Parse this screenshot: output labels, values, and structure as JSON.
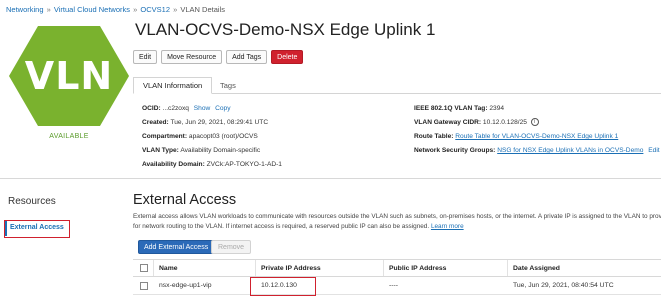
{
  "breadcrumb": {
    "items": [
      "Networking",
      "Virtual Cloud Networks",
      "OCVS12",
      "VLAN Details"
    ],
    "separator": "»"
  },
  "resource_icon": {
    "label": "VLN",
    "color": "#7ab22e"
  },
  "status": "AVAILABLE",
  "title": "VLAN-OCVS-Demo-NSX Edge Uplink 1",
  "actions": {
    "edit": "Edit",
    "move": "Move Resource",
    "tags": "Add Tags",
    "delete": "Delete"
  },
  "tabs": {
    "info": "VLAN Information",
    "tags": "Tags"
  },
  "info_left": {
    "ocid_label": "OCID:",
    "ocid_value": "...c2zoxq",
    "ocid_show": "Show",
    "ocid_copy": "Copy",
    "created_label": "Created:",
    "created_value": "Tue, Jun 29, 2021, 08:29:41 UTC",
    "compartment_label": "Compartment:",
    "compartment_value": "apacopt03 (root)/OCVS",
    "type_label": "VLAN Type:",
    "type_value": "Availability Domain-specific",
    "ad_label": "Availability Domain:",
    "ad_value": "ZVCk:AP-TOKYO-1-AD-1"
  },
  "info_right": {
    "tag_label": "IEEE 802.1Q VLAN Tag:",
    "tag_value": "2394",
    "cidr_label": "VLAN Gateway CIDR:",
    "cidr_value": "10.12.0.128/25",
    "cidr_info": "i",
    "route_label": "Route Table:",
    "route_value": "Route Table for VLAN-OCVS-Demo-NSX Edge Uplink 1",
    "nsg_label": "Network Security Groups:",
    "nsg_value": "NSG for NSX Edge Uplink VLANs in OCVS-Demo",
    "nsg_edit": "Edit"
  },
  "resources": {
    "heading": "Resources",
    "item": "External Access"
  },
  "section": {
    "title": "External Access",
    "desc_line1": "External access allows VLAN workloads to communicate with resources outside the VLAN such as subnets, on-premises hosts, or the internet. A private IP is assigned to the VLAN to prov",
    "desc_line2": "for network routing to the VLAN. If internet access is required, a reserved public IP can also be assigned.",
    "learn_more": "Learn more",
    "add_button": "Add External Access",
    "remove_button": "Remove"
  },
  "table": {
    "headers": [
      "Name",
      "Private IP Address",
      "Public IP Address",
      "Date Assigned"
    ],
    "rows": [
      {
        "name": "nsx-edge-up1-vip",
        "private_ip": "10.12.0.130",
        "public_ip": "----",
        "date": "Tue, Jun 29, 2021, 08:40:54 UTC"
      }
    ]
  },
  "colors": {
    "accent": "#1a6fb5",
    "danger": "#d0212e",
    "primary": "#2b6ab8",
    "status": "#5a9b2a"
  }
}
